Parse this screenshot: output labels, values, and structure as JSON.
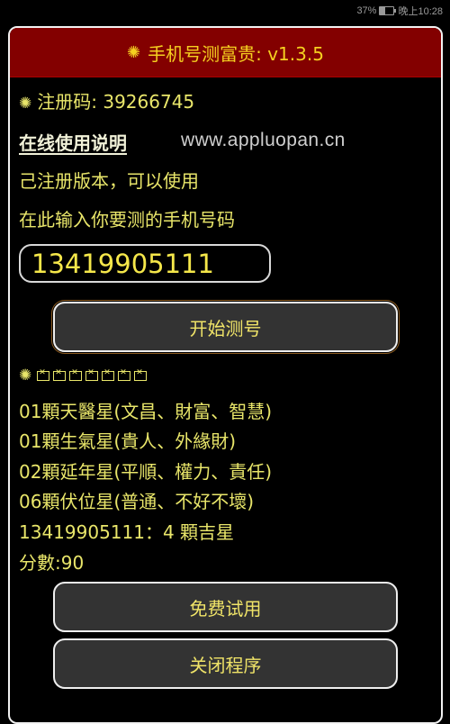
{
  "status_bar": {
    "battery": "37%",
    "time": "晚上10:28"
  },
  "dialog": {
    "title_icon": "✺",
    "title": "手机号测富贵: v1.3.5"
  },
  "registration": {
    "icon": "✺",
    "code_label": "注册码: 39266745",
    "online_help_link": "在线使用说明",
    "watermark": "www.appluopan.cn",
    "status": "己注册版本，可以使用",
    "input_prompt": "在此输入你要测的手机号码"
  },
  "phone_input": {
    "value": "13419905111"
  },
  "buttons": {
    "start": "开始测号",
    "trial": "免费试用",
    "close": "关闭程序"
  },
  "result": {
    "icon": "✺",
    "box_count": 7,
    "lines": [
      "01顆天醫星(文昌、財富、智慧)",
      "01顆生氣星(貴人、外緣財)",
      "02顆延年星(平順、權力、責任)",
      "06顆伏位星(普通、不好不壞)",
      "13419905111：4 顆吉星",
      "分數:90"
    ]
  },
  "colors": {
    "title_bar": "#830000",
    "text": "#e9e66a",
    "button_bg": "#333333"
  }
}
